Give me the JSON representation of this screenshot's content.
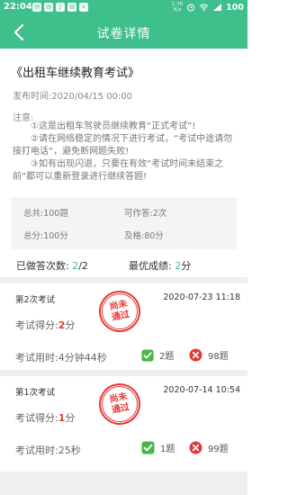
{
  "status_bar": {
    "time": "22:04",
    "network_speed_top": "1.70",
    "network_speed_bottom": "K/s",
    "battery": "100"
  },
  "app_bar": {
    "title": "试卷详情",
    "back_icon": "chevron-left-icon"
  },
  "exam": {
    "title": "《出租车继续教育考试》",
    "publish_label": "发布时间:",
    "publish_time": "2020/04/15 00:00",
    "notice_label": "注意:",
    "notice_lines": [
      "①这是出租车驾驶员继续教育“正式考试”!",
      "②请在网络稳定的情况下进行考试，“考试中途请勿接打电话”，避免断网题失败!",
      "③如有出现闪退，只要在有效“考试时间未结束之前”都可以重新登录进行继续答题!"
    ]
  },
  "stats": {
    "total_questions": "总共:100题",
    "attempts_allowed": "可作答:2次",
    "total_score": "总分:100分",
    "pass_score": "及格:80分"
  },
  "summary": {
    "done_label": "已做答次数:",
    "done_value": "2",
    "done_total": "/2",
    "best_label": "最优成绩:",
    "best_value": "2",
    "best_unit": "分"
  },
  "records": [
    {
      "name": "第2次考试",
      "date": "2020-07-23 11:18",
      "score_label": "考试得分:",
      "score_value": "2",
      "score_unit": "分",
      "stamp_line1": "尚未",
      "stamp_line2": "通过",
      "time_used": "考试用时:4分钟44秒",
      "correct": "2题",
      "wrong": "98题"
    },
    {
      "name": "第1次考试",
      "date": "2020-07-14 10:54",
      "score_label": "考试得分:",
      "score_value": "1",
      "score_unit": "分",
      "stamp_line1": "尚未",
      "stamp_line2": "通过",
      "time_used": "考试用时:25秒",
      "correct": "1题",
      "wrong": "99题"
    }
  ],
  "colors": {
    "brand": "#3fbf8b",
    "fail_red": "#e53935",
    "correct_green": "#49b649"
  }
}
